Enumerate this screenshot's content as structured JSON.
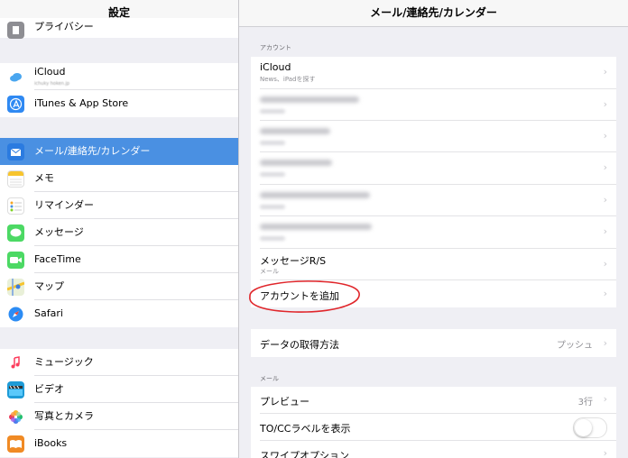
{
  "left": {
    "title": "設定",
    "items": [
      {
        "label": "プライバシー"
      },
      {
        "label": "iCloud",
        "sublabel": "ichuky hoken.jp"
      },
      {
        "label": "iTunes & App Store"
      },
      {
        "label": "メール/連絡先/カレンダー",
        "selected": true
      },
      {
        "label": "メモ"
      },
      {
        "label": "リマインダー"
      },
      {
        "label": "メッセージ"
      },
      {
        "label": "FaceTime"
      },
      {
        "label": "マップ"
      },
      {
        "label": "Safari"
      },
      {
        "label": "ミュージック"
      },
      {
        "label": "ビデオ"
      },
      {
        "label": "写真とカメラ"
      },
      {
        "label": "iBooks"
      }
    ]
  },
  "right": {
    "title": "メール/連絡先/カレンダー",
    "accounts_header": "アカウント",
    "accounts": [
      {
        "title": "iCloud",
        "subtitle": "News、iPadを探す"
      },
      {
        "title": "メッセージR/S",
        "subtitle": "メール"
      }
    ],
    "add_account": "アカウントを追加",
    "fetch_label": "データの取得方法",
    "fetch_value": "プッシュ",
    "mail_header": "メール",
    "preview_label": "プレビュー",
    "preview_value": "3行",
    "tocc_label": "TO/CCラベルを表示",
    "swipe_label": "スワイプオプション"
  },
  "colors": {
    "selected": "#4a90e2",
    "annotation": "#e0262b",
    "chevron": "#c7c7cc"
  }
}
